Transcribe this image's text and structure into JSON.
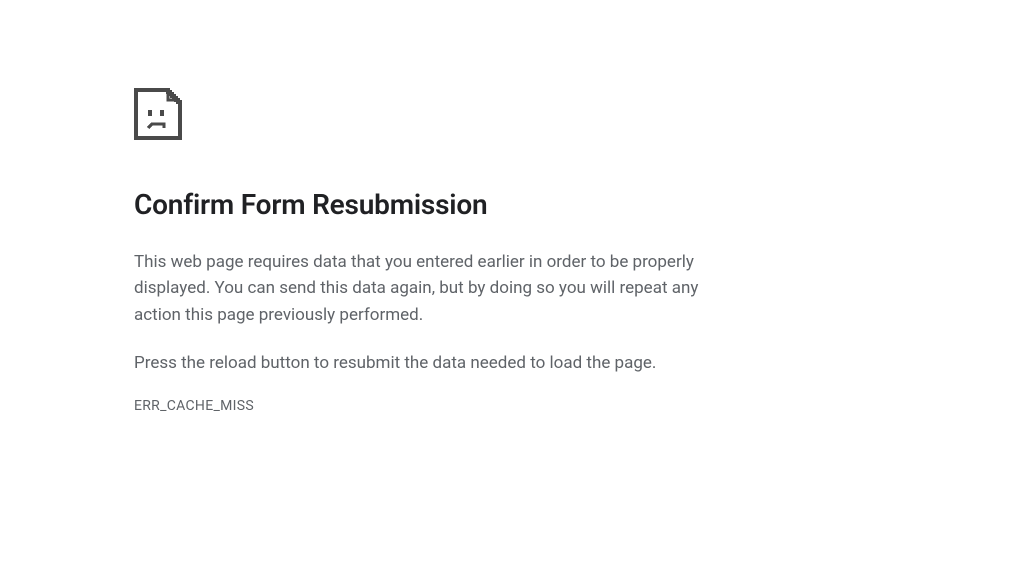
{
  "error": {
    "title": "Confirm Form Resubmission",
    "paragraph1": "This web page requires data that you entered earlier in order to be properly displayed. You can send this data again, but by doing so you will repeat any action this page previously performed.",
    "paragraph2": "Press the reload button to resubmit the data needed to load the page.",
    "code": "ERR_CACHE_MISS",
    "icon": "sad-page-icon"
  }
}
